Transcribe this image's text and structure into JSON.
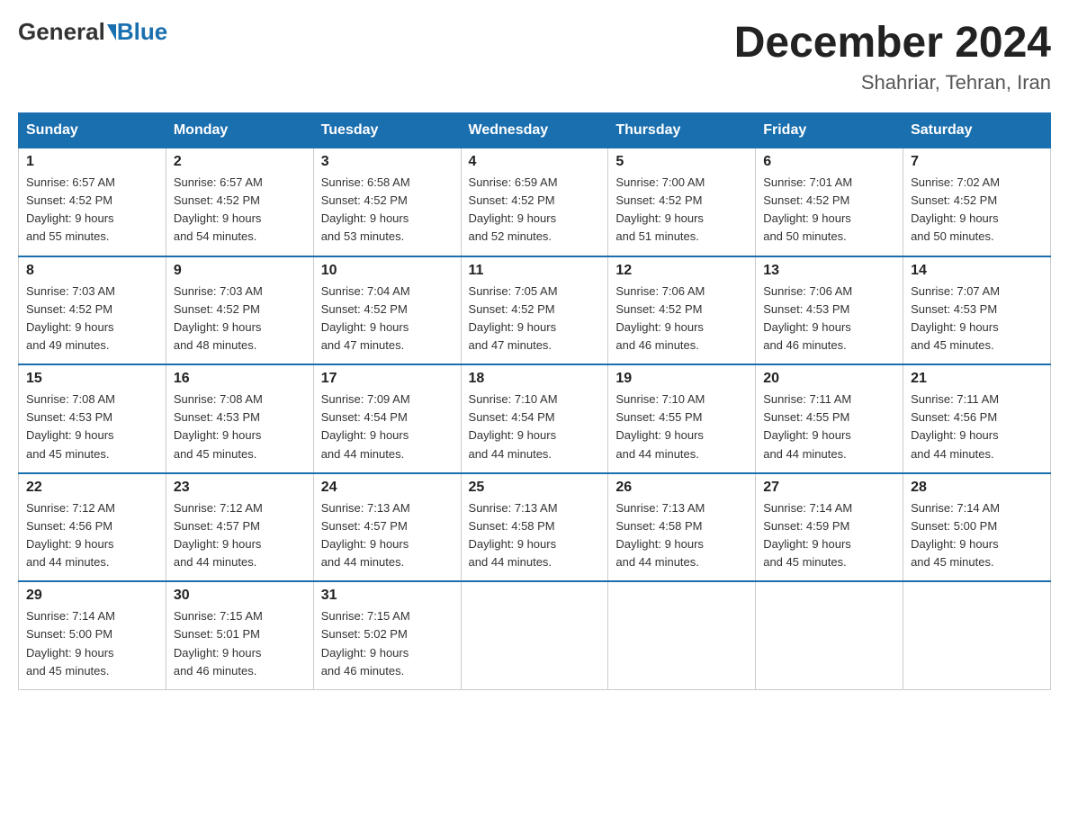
{
  "header": {
    "logo_general": "General",
    "logo_blue": "Blue",
    "month_title": "December 2024",
    "location": "Shahriar, Tehran, Iran"
  },
  "weekdays": [
    "Sunday",
    "Monday",
    "Tuesday",
    "Wednesday",
    "Thursday",
    "Friday",
    "Saturday"
  ],
  "weeks": [
    [
      {
        "day": "1",
        "sunrise": "6:57 AM",
        "sunset": "4:52 PM",
        "daylight": "9 hours and 55 minutes."
      },
      {
        "day": "2",
        "sunrise": "6:57 AM",
        "sunset": "4:52 PM",
        "daylight": "9 hours and 54 minutes."
      },
      {
        "day": "3",
        "sunrise": "6:58 AM",
        "sunset": "4:52 PM",
        "daylight": "9 hours and 53 minutes."
      },
      {
        "day": "4",
        "sunrise": "6:59 AM",
        "sunset": "4:52 PM",
        "daylight": "9 hours and 52 minutes."
      },
      {
        "day": "5",
        "sunrise": "7:00 AM",
        "sunset": "4:52 PM",
        "daylight": "9 hours and 51 minutes."
      },
      {
        "day": "6",
        "sunrise": "7:01 AM",
        "sunset": "4:52 PM",
        "daylight": "9 hours and 50 minutes."
      },
      {
        "day": "7",
        "sunrise": "7:02 AM",
        "sunset": "4:52 PM",
        "daylight": "9 hours and 50 minutes."
      }
    ],
    [
      {
        "day": "8",
        "sunrise": "7:03 AM",
        "sunset": "4:52 PM",
        "daylight": "9 hours and 49 minutes."
      },
      {
        "day": "9",
        "sunrise": "7:03 AM",
        "sunset": "4:52 PM",
        "daylight": "9 hours and 48 minutes."
      },
      {
        "day": "10",
        "sunrise": "7:04 AM",
        "sunset": "4:52 PM",
        "daylight": "9 hours and 47 minutes."
      },
      {
        "day": "11",
        "sunrise": "7:05 AM",
        "sunset": "4:52 PM",
        "daylight": "9 hours and 47 minutes."
      },
      {
        "day": "12",
        "sunrise": "7:06 AM",
        "sunset": "4:52 PM",
        "daylight": "9 hours and 46 minutes."
      },
      {
        "day": "13",
        "sunrise": "7:06 AM",
        "sunset": "4:53 PM",
        "daylight": "9 hours and 46 minutes."
      },
      {
        "day": "14",
        "sunrise": "7:07 AM",
        "sunset": "4:53 PM",
        "daylight": "9 hours and 45 minutes."
      }
    ],
    [
      {
        "day": "15",
        "sunrise": "7:08 AM",
        "sunset": "4:53 PM",
        "daylight": "9 hours and 45 minutes."
      },
      {
        "day": "16",
        "sunrise": "7:08 AM",
        "sunset": "4:53 PM",
        "daylight": "9 hours and 45 minutes."
      },
      {
        "day": "17",
        "sunrise": "7:09 AM",
        "sunset": "4:54 PM",
        "daylight": "9 hours and 44 minutes."
      },
      {
        "day": "18",
        "sunrise": "7:10 AM",
        "sunset": "4:54 PM",
        "daylight": "9 hours and 44 minutes."
      },
      {
        "day": "19",
        "sunrise": "7:10 AM",
        "sunset": "4:55 PM",
        "daylight": "9 hours and 44 minutes."
      },
      {
        "day": "20",
        "sunrise": "7:11 AM",
        "sunset": "4:55 PM",
        "daylight": "9 hours and 44 minutes."
      },
      {
        "day": "21",
        "sunrise": "7:11 AM",
        "sunset": "4:56 PM",
        "daylight": "9 hours and 44 minutes."
      }
    ],
    [
      {
        "day": "22",
        "sunrise": "7:12 AM",
        "sunset": "4:56 PM",
        "daylight": "9 hours and 44 minutes."
      },
      {
        "day": "23",
        "sunrise": "7:12 AM",
        "sunset": "4:57 PM",
        "daylight": "9 hours and 44 minutes."
      },
      {
        "day": "24",
        "sunrise": "7:13 AM",
        "sunset": "4:57 PM",
        "daylight": "9 hours and 44 minutes."
      },
      {
        "day": "25",
        "sunrise": "7:13 AM",
        "sunset": "4:58 PM",
        "daylight": "9 hours and 44 minutes."
      },
      {
        "day": "26",
        "sunrise": "7:13 AM",
        "sunset": "4:58 PM",
        "daylight": "9 hours and 44 minutes."
      },
      {
        "day": "27",
        "sunrise": "7:14 AM",
        "sunset": "4:59 PM",
        "daylight": "9 hours and 45 minutes."
      },
      {
        "day": "28",
        "sunrise": "7:14 AM",
        "sunset": "5:00 PM",
        "daylight": "9 hours and 45 minutes."
      }
    ],
    [
      {
        "day": "29",
        "sunrise": "7:14 AM",
        "sunset": "5:00 PM",
        "daylight": "9 hours and 45 minutes."
      },
      {
        "day": "30",
        "sunrise": "7:15 AM",
        "sunset": "5:01 PM",
        "daylight": "9 hours and 46 minutes."
      },
      {
        "day": "31",
        "sunrise": "7:15 AM",
        "sunset": "5:02 PM",
        "daylight": "9 hours and 46 minutes."
      },
      null,
      null,
      null,
      null
    ]
  ],
  "labels": {
    "sunrise": "Sunrise:",
    "sunset": "Sunset:",
    "daylight": "Daylight:"
  }
}
